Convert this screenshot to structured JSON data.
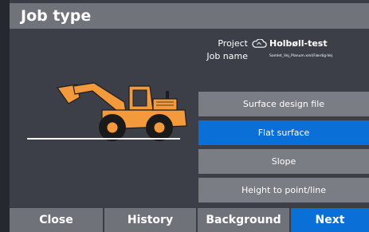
{
  "dialog": {
    "title": "Job type"
  },
  "project": {
    "project_label": "Project",
    "project_value": "Holbøll-test",
    "job_label": "Job name",
    "job_value": "Samlet_Vej_Planum.xml(Færdig-Vej"
  },
  "options": [
    {
      "label": "Surface design file",
      "selected": false
    },
    {
      "label": "Flat surface",
      "selected": true
    },
    {
      "label": "Slope",
      "selected": false
    },
    {
      "label": "Height to point/line",
      "selected": false
    }
  ],
  "footer": {
    "close_label": "Close",
    "history_label": "History",
    "background_label": "Background",
    "next_label": "Next"
  },
  "colors": {
    "accent": "#0a6fd6",
    "machine": "#f39a3c",
    "background": "#3b3e46",
    "button": "#6f7278"
  },
  "icons": {
    "cloud": "cloud-sync-icon",
    "machine": "wheel-loader-icon"
  }
}
